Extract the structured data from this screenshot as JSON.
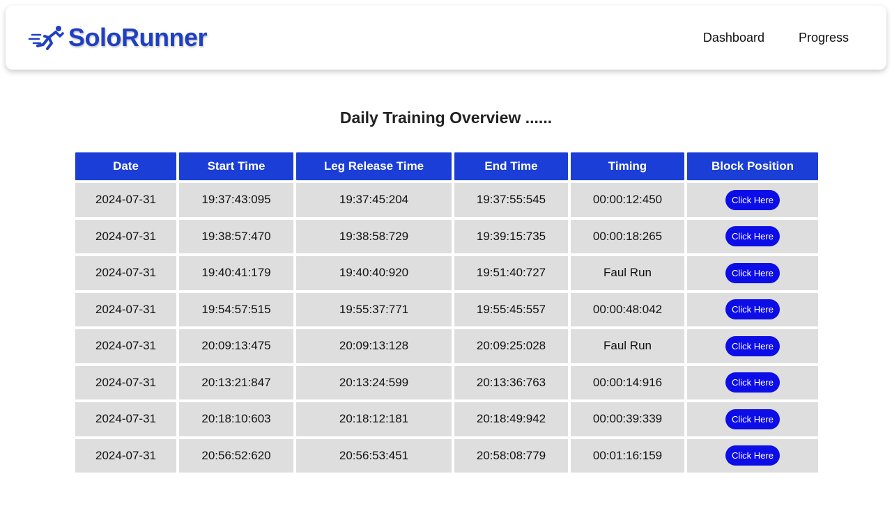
{
  "brand": {
    "name": "SoloRunner",
    "logo_icon": "runner-icon",
    "color": "#1f3fc4"
  },
  "nav": {
    "items": [
      {
        "label": "Dashboard"
      },
      {
        "label": "Progress"
      }
    ]
  },
  "main": {
    "title": "Daily Training Overview ......",
    "table": {
      "header_color": "#1a3ed6",
      "columns": [
        "Date",
        "Start Time",
        "Leg Release Time",
        "End Time",
        "Timing",
        "Block Position"
      ],
      "rows": [
        {
          "date": "2024-07-31",
          "start": "19:37:43:095",
          "leg_release": "19:37:45:204",
          "end": "19:37:55:545",
          "timing": "00:00:12:450",
          "action": "Click Here"
        },
        {
          "date": "2024-07-31",
          "start": "19:38:57:470",
          "leg_release": "19:38:58:729",
          "end": "19:39:15:735",
          "timing": "00:00:18:265",
          "action": "Click Here"
        },
        {
          "date": "2024-07-31",
          "start": "19:40:41:179",
          "leg_release": "19:40:40:920",
          "end": "19:51:40:727",
          "timing": "Faul Run",
          "action": "Click Here"
        },
        {
          "date": "2024-07-31",
          "start": "19:54:57:515",
          "leg_release": "19:55:37:771",
          "end": "19:55:45:557",
          "timing": "00:00:48:042",
          "action": "Click Here"
        },
        {
          "date": "2024-07-31",
          "start": "20:09:13:475",
          "leg_release": "20:09:13:128",
          "end": "20:09:25:028",
          "timing": "Faul Run",
          "action": "Click Here"
        },
        {
          "date": "2024-07-31",
          "start": "20:13:21:847",
          "leg_release": "20:13:24:599",
          "end": "20:13:36:763",
          "timing": "00:00:14:916",
          "action": "Click Here"
        },
        {
          "date": "2024-07-31",
          "start": "20:18:10:603",
          "leg_release": "20:18:12:181",
          "end": "20:18:49:942",
          "timing": "00:00:39:339",
          "action": "Click Here"
        },
        {
          "date": "2024-07-31",
          "start": "20:56:52:620",
          "leg_release": "20:56:53:451",
          "end": "20:58:08:779",
          "timing": "00:01:16:159",
          "action": "Click Here"
        }
      ],
      "button_color": "#0d0de8"
    }
  }
}
